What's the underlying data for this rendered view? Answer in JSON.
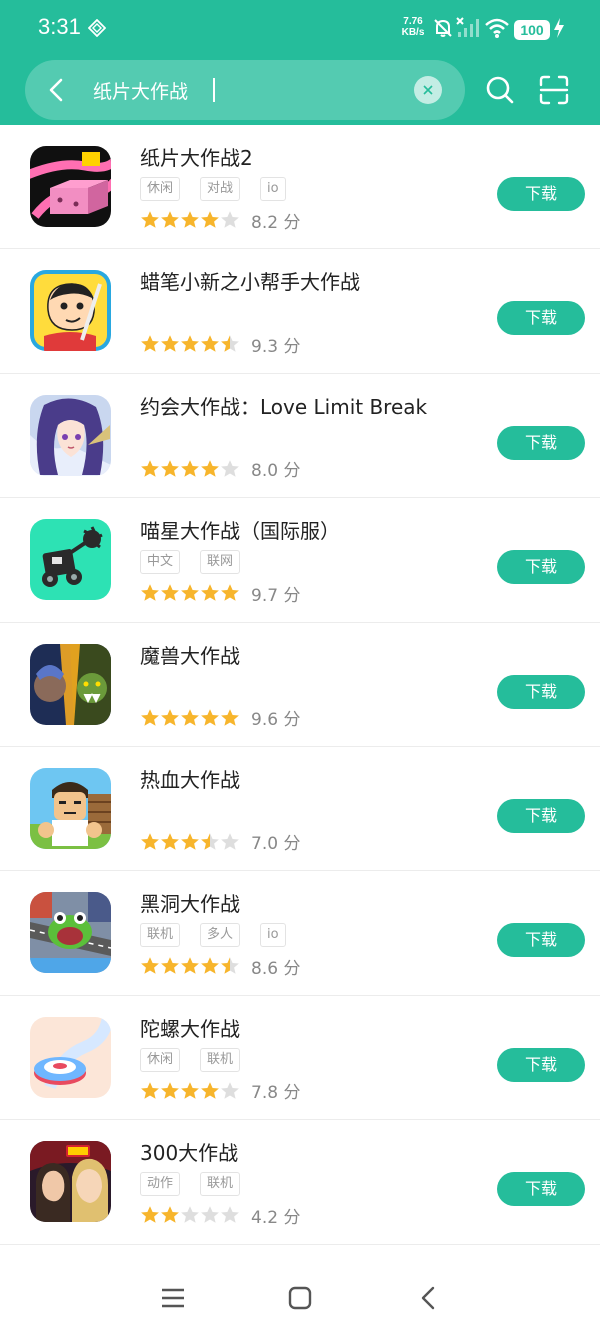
{
  "status_bar": {
    "time": "3:31",
    "net_speed_value": "7.76",
    "net_speed_unit": "KB/s",
    "battery": "100",
    "icons": [
      "diamond-icon",
      "bell-off-icon",
      "signal-icon",
      "wifi-icon",
      "battery-icon",
      "charging-icon"
    ]
  },
  "search": {
    "query": "纸片大作战",
    "icons": [
      "back-icon",
      "clear-icon",
      "search-icon",
      "scan-icon"
    ]
  },
  "accent_color": "#25bd9b",
  "star_color": "#f7b52c",
  "apps": [
    {
      "name": "纸片大作战2",
      "tags": [
        "休闲",
        "对战",
        "io"
      ],
      "stars": 4,
      "score": "8.2 分",
      "button": "下载"
    },
    {
      "name": "蜡笔小新之小帮手大作战",
      "tags": [],
      "stars": 4.5,
      "score": "9.3 分",
      "button": "下载"
    },
    {
      "name": "约会大作战：Love Limit Break",
      "tags": [],
      "stars": 4,
      "score": "8.0 分",
      "button": "下载"
    },
    {
      "name": "喵星大作战（国际服）",
      "tags": [
        "中文",
        "联网"
      ],
      "stars": 5,
      "score": "9.7 分",
      "button": "下载"
    },
    {
      "name": "魔兽大作战",
      "tags": [],
      "stars": 5,
      "score": "9.6 分",
      "button": "下载"
    },
    {
      "name": "热血大作战",
      "tags": [],
      "stars": 3.5,
      "score": "7.0 分",
      "button": "下载"
    },
    {
      "name": "黑洞大作战",
      "tags": [
        "联机",
        "多人",
        "io"
      ],
      "stars": 4.5,
      "score": "8.6 分",
      "button": "下载"
    },
    {
      "name": "陀螺大作战",
      "tags": [
        "休闲",
        "联机"
      ],
      "stars": 4,
      "score": "7.8 分",
      "button": "下载"
    },
    {
      "name": "300大作战",
      "tags": [
        "动作",
        "联机"
      ],
      "stars": 2,
      "score": "4.2 分",
      "button": "下载"
    }
  ],
  "nav_bar": {
    "icons": [
      "menu-icon",
      "home-icon",
      "back-nav-icon"
    ]
  }
}
